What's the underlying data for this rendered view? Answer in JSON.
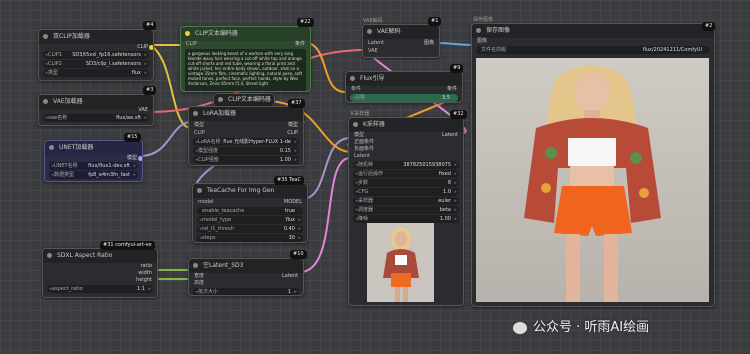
{
  "colors": {
    "clip": "#f5d03a",
    "model": "#b39ddb",
    "vae": "#ff6e6e",
    "latent": "#f58ee8",
    "conditioning": "#ffa931",
    "image": "#64b5f6",
    "int": "#8bc34a"
  },
  "nodes": {
    "dual_clip": {
      "badge": "#4",
      "title": "双CLIP加载器",
      "out": "CLIP",
      "widgets": [
        {
          "label": "CLIP1",
          "value": "SD3/t5xxl_fp16.safetensors"
        },
        {
          "label": "CLIP2",
          "value": "SD3/clip_l.safetensors"
        },
        {
          "label": "类型",
          "value": "flux"
        }
      ]
    },
    "vae_loader": {
      "badge": "#3",
      "title": "VAE加载器",
      "out": "VAE",
      "widgets": [
        {
          "label": "vae名称",
          "value": "flux/ae.sft"
        }
      ]
    },
    "unet_loader": {
      "badge": "#15",
      "title": "UNET加载器",
      "out": "模型",
      "widgets": [
        {
          "label": "UNET名称",
          "value": "flux/flux1-dev.sft"
        },
        {
          "label": "数据类型",
          "value": "fp8_e4m3fn_fast"
        }
      ]
    },
    "clip_text": {
      "badge": "#22",
      "title": "CLIP文本编码器",
      "in": "CLIP",
      "out": "条件",
      "text": "a gorgeous looking beast of a woman with very long blonde wavy hair wearing a cut-off white top and orange cut-off shorts and red tube, wearing a floral print and white jacket, her entire body shown, outdoor, shot on a vintage 35mm film, cinematic lighting, natural pose, soft muted tones, perfect face, perfect hands, style by Wes Anderson, Zeiss 85mm f1.4, Street light"
    },
    "clip_text2": {
      "badge": "",
      "title": "CLIP文本编码器"
    },
    "lora": {
      "badge": "#37",
      "title": "LoRA加载器",
      "in": [
        "模型",
        "CLIP"
      ],
      "out": [
        "模型",
        "CLIP"
      ],
      "widgets": [
        {
          "label": "LoRA名称",
          "value": "flux 光线影Hyper-FLUX 1-de"
        },
        {
          "label": "模型强度",
          "value": "0.15"
        },
        {
          "label": "CLIP强度",
          "value": "1.00"
        }
      ]
    },
    "teacache": {
      "badge": "#35 TeaC",
      "title": "TeaCache For Img Gen",
      "in": "model",
      "out": "MODEL",
      "widgets": [
        {
          "label": "enable_teacache",
          "value": "true"
        },
        {
          "label": "model_type",
          "value": "flux"
        },
        {
          "label": "rel_l1_thresh",
          "value": "0.40"
        },
        {
          "label": "steps",
          "value": "30"
        }
      ]
    },
    "sdxl_ratio": {
      "badge": "#31 comfyui-art-ve",
      "title": "SDXL Aspect Ratio",
      "out": [
        "ratio",
        "width",
        "height"
      ],
      "widgets": [
        {
          "label": "aspect_ratio",
          "value": "1:1"
        }
      ]
    },
    "latent_sd3": {
      "badge": "#10",
      "title": "空Latent_SD3",
      "in": [
        "宽度",
        "高度"
      ],
      "out": "Latent",
      "widgets": [
        {
          "label": "批次大小",
          "value": "1"
        }
      ]
    },
    "vae_decode": {
      "badge": "#1",
      "title": "VAE解码",
      "in": [
        "Latent",
        "VAE"
      ],
      "out": "图像"
    },
    "flux_guide": {
      "badge": "#9",
      "title": "Flux引导",
      "in": "条件",
      "out": "条件",
      "widgets": [
        {
          "label": "引导",
          "value": "3.5"
        }
      ]
    },
    "ksampler": {
      "badge": "#32",
      "title": "K采样器",
      "in": [
        "模型",
        "正面条件",
        "负面条件",
        "Latent"
      ],
      "out": "Latent",
      "widgets": [
        {
          "label": "随机种",
          "value": "387825015938075"
        },
        {
          "label": "运行后操作",
          "value": "fixed"
        },
        {
          "label": "步数",
          "value": "8"
        },
        {
          "label": "CFG",
          "value": "1.0"
        },
        {
          "label": "采样器",
          "value": "euler"
        },
        {
          "label": "调度器",
          "value": "beta"
        },
        {
          "label": "降噪",
          "value": "1.00"
        }
      ]
    },
    "save_image": {
      "badge": "#2",
      "title": "保存图像",
      "in": "图像",
      "widgets": [
        {
          "label": "文件名前缀",
          "value": "flux/20241211/ComfyUI"
        }
      ]
    }
  },
  "small_labels": {
    "vae_decode_top": "VAE解码",
    "clip_top": "CLIP文本编码器",
    "ks_top": "K采样器",
    "save_top": "保存图像"
  },
  "watermark": "公众号 · 听雨AI绘画"
}
